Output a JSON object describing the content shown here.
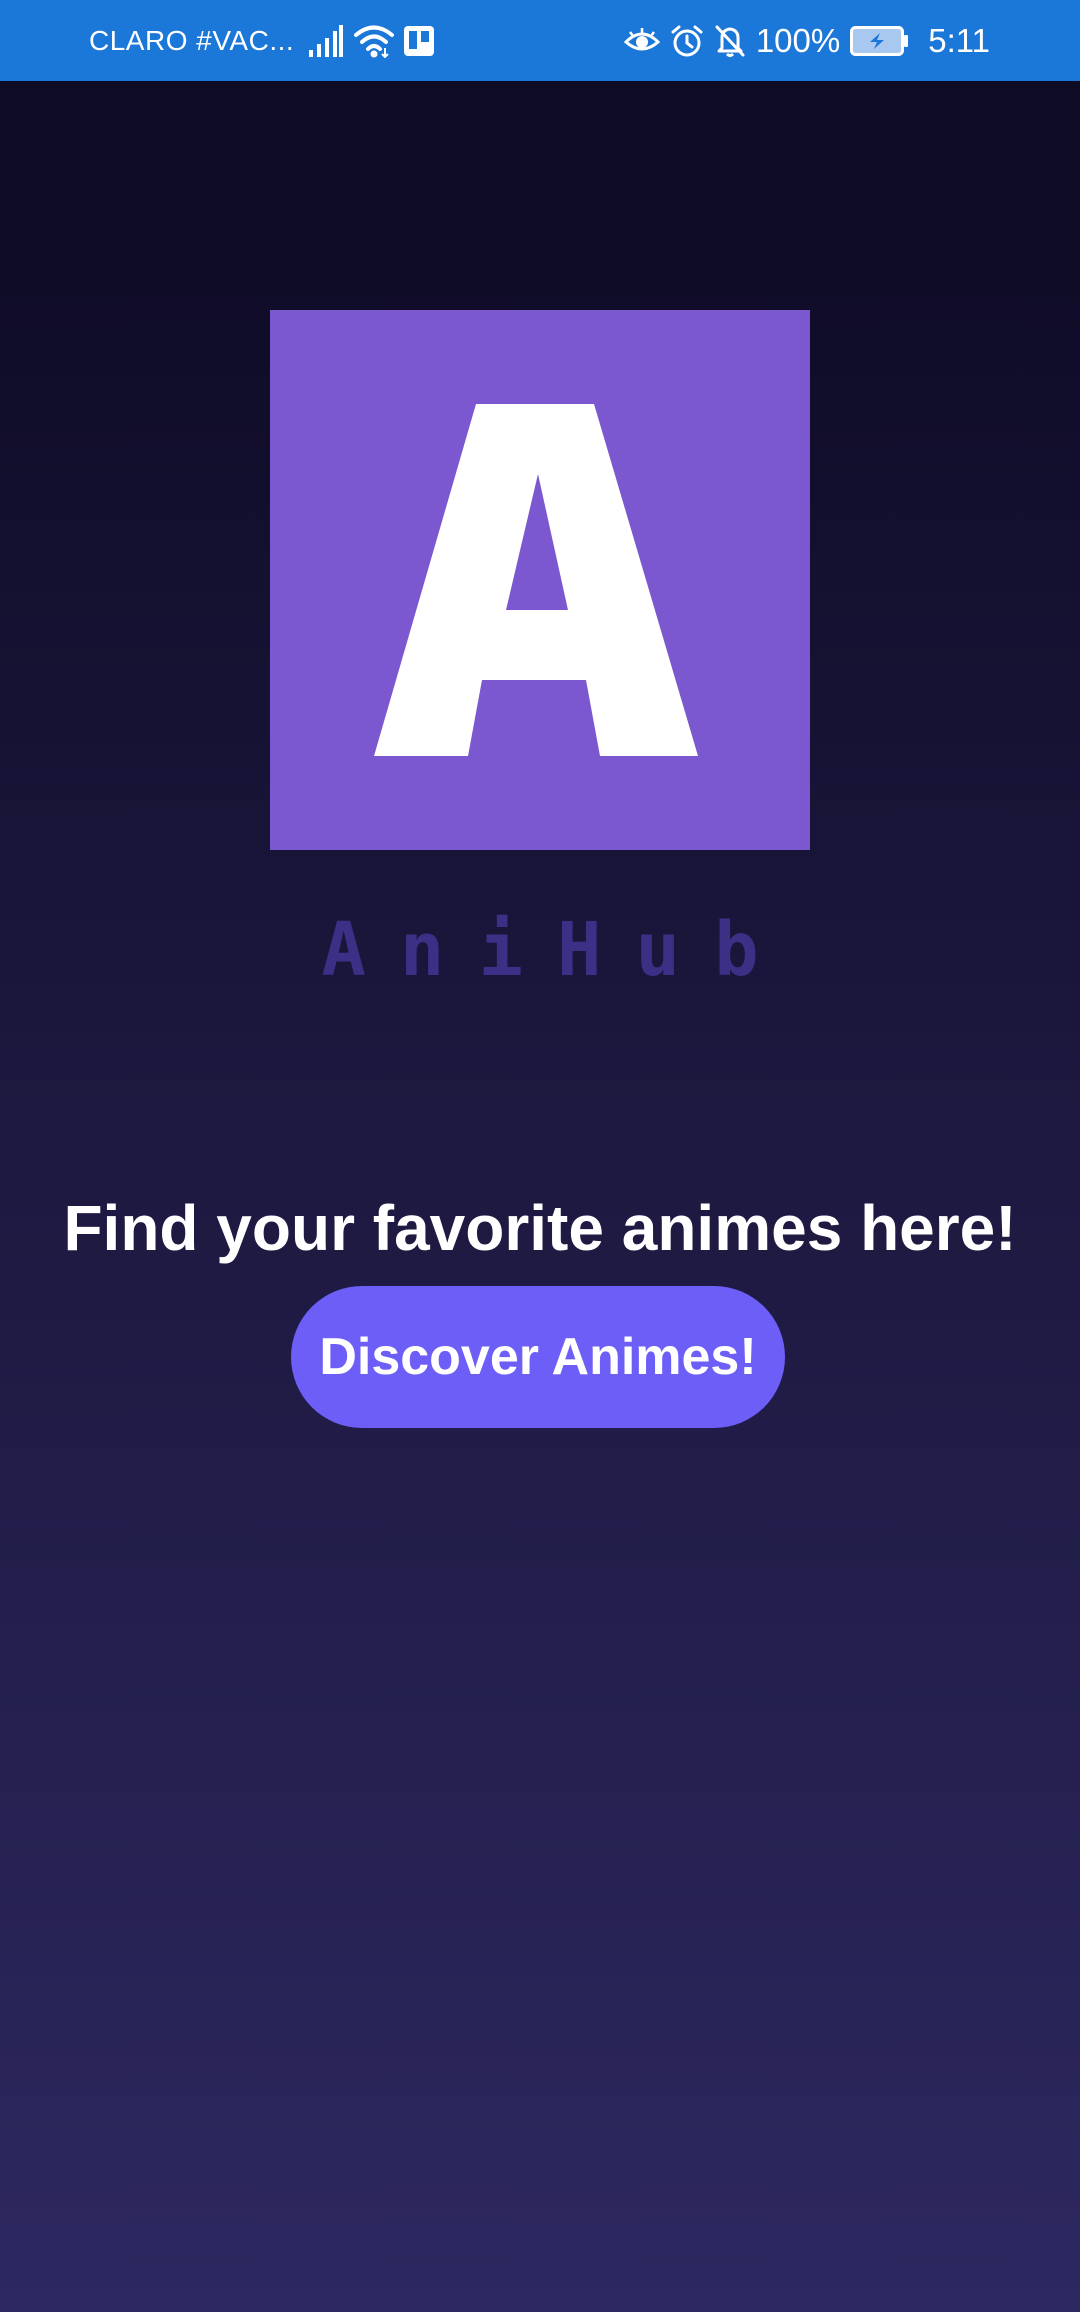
{
  "status_bar": {
    "carrier": "CLARO #VAC...",
    "battery_percent": "100%",
    "time": "5:11",
    "icons_left": [
      "signal-icon",
      "wifi-icon",
      "trello-icon"
    ],
    "icons_right": [
      "eye-icon",
      "alarm-icon",
      "bell-off-icon",
      "battery-charging-icon"
    ],
    "background_color": "#1b77d8"
  },
  "logo": {
    "letter": "A",
    "background_color": "#7b58d0"
  },
  "app": {
    "name": "AniHub",
    "name_color": "#3c2f86"
  },
  "main": {
    "tagline": "Find your favorite animes here!",
    "discover_button_label": "Discover Animes!",
    "button_color": "#6c5ef7"
  }
}
